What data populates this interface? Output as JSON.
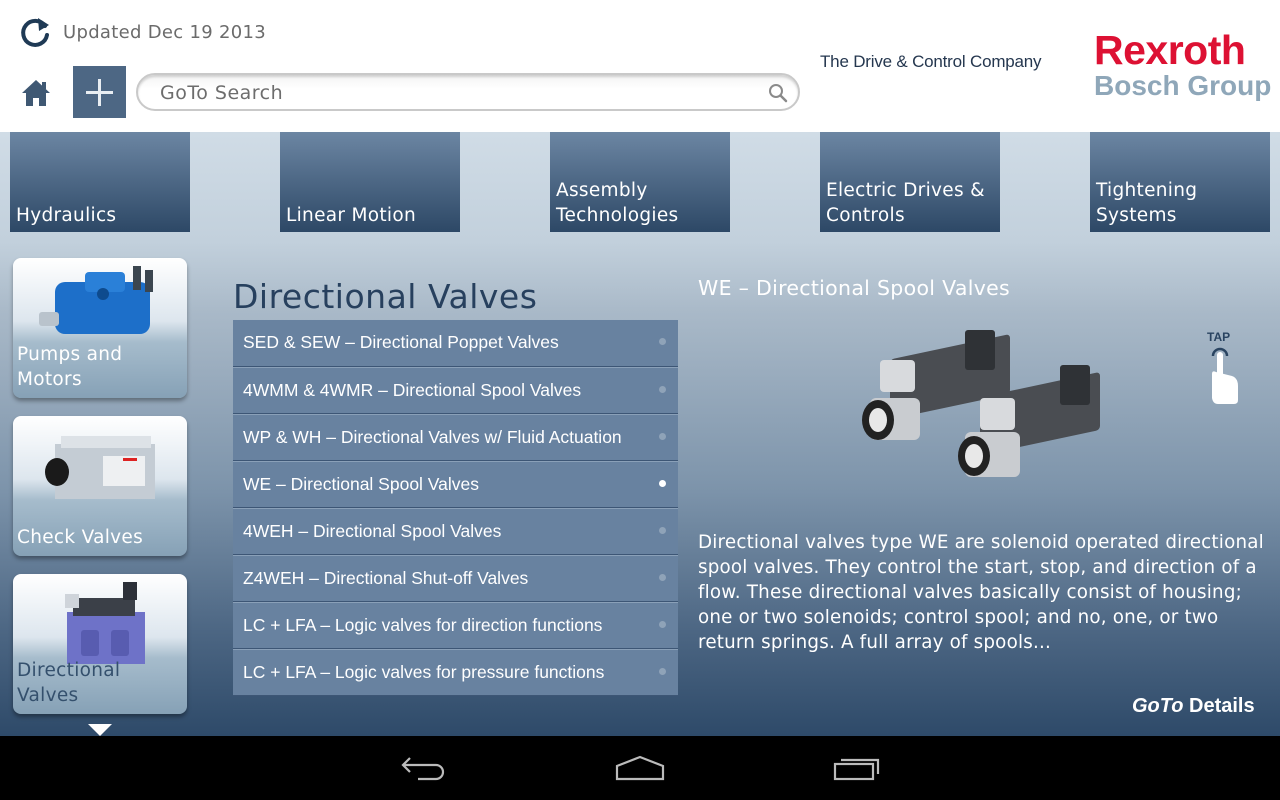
{
  "header": {
    "updated_text": "Updated Dec 19 2013",
    "search_placeholder": "GoTo Search",
    "tagline": "The Drive & Control Company",
    "logo_line1": "Rexroth",
    "logo_line2": "Bosch Group",
    "icons": {
      "refresh": "refresh-icon",
      "home": "home-icon",
      "add": "plus-icon",
      "search": "search-icon"
    }
  },
  "categories": [
    {
      "label": "Hydraulics"
    },
    {
      "label": "Linear Motion"
    },
    {
      "label": "Assembly Technologies"
    },
    {
      "label": "Electric Drives & Controls"
    },
    {
      "label": "Tightening Systems"
    }
  ],
  "sidebar": {
    "items": [
      {
        "label": "Pumps and Motors",
        "active": false
      },
      {
        "label": "Check Valves",
        "active": false
      },
      {
        "label": "Directional Valves",
        "active": true
      }
    ],
    "more_indicator": "chevron-down-icon"
  },
  "list": {
    "title": "Directional Valves",
    "items": [
      {
        "label": "SED & SEW – Directional Poppet Valves",
        "selected": false
      },
      {
        "label": "4WMM & 4WMR – Directional Spool Valves",
        "selected": false
      },
      {
        "label": "WP & WH – Directional Valves w/ Fluid Actuation",
        "selected": false
      },
      {
        "label": "WE – Directional Spool Valves",
        "selected": true
      },
      {
        "label": "4WEH – Directional Spool Valves",
        "selected": false
      },
      {
        "label": "Z4WEH – Directional Shut-off Valves",
        "selected": false
      },
      {
        "label": "LC + LFA – Logic valves for direction functions",
        "selected": false
      },
      {
        "label": "LC + LFA – Logic valves for pressure functions",
        "selected": false
      }
    ]
  },
  "detail": {
    "title": "WE – Directional Spool Valves",
    "tap_label": "TAP",
    "description": "Directional valves type WE are solenoid operated directional spool valves. They control the start, stop, and direction of a flow. These directional valves basically consist of housing; one or two solenoids; control spool; and no, one, or two return springs. A full array of spools...",
    "goto_prefix": "GoTo",
    "goto_suffix": " Details"
  },
  "navbar": {
    "back": "back-icon",
    "home": "home-icon",
    "recents": "recents-icon"
  },
  "colors": {
    "brand_red": "#dd1133",
    "brand_gray": "#8fa7b9",
    "tile_top": "#6c86a3",
    "tile_bottom": "#2d4866",
    "list_item_bg": "#6882a0",
    "title_dark": "#27405e"
  }
}
